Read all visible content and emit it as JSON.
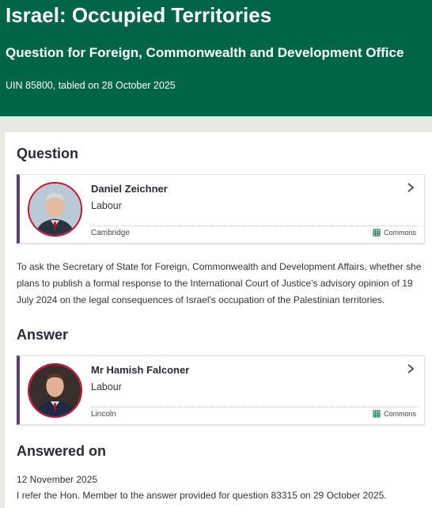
{
  "header": {
    "title": "Israel: Occupied Territories",
    "subtitle": "Question for Foreign, Commonwealth and Development Office",
    "uin": "UIN 85800, tabled on 28 October 2025"
  },
  "question": {
    "heading": "Question",
    "member": {
      "name": "Daniel Zeichner",
      "party": "Labour",
      "constituency": "Cambridge",
      "house": "Commons"
    },
    "text": "To ask the Secretary of State for Foreign, Commonwealth and Development Affairs, whether she plans to publish a formal response to the International Court of Justice's advisory opinion of 19 July 2024 on the legal consequences of Israel's occupation of the Palestinian territories."
  },
  "answer": {
    "heading": "Answer",
    "member": {
      "name": "Mr Hamish Falconer",
      "party": "Labour",
      "constituency": "Lincoln",
      "house": "Commons"
    }
  },
  "answered_on": {
    "heading": "Answered on",
    "date": "12 November 2025",
    "text": "I refer the Hon. Member to the answer provided for question 83315 on 29 October 2025."
  },
  "colors": {
    "header_bg": "#006548",
    "card_accent": "#5a3f78",
    "party_ring": "#c8102e",
    "commons_green": "#00703c"
  },
  "icons": {
    "chevron": "chevron-right-icon",
    "house": "portcullis-icon"
  }
}
